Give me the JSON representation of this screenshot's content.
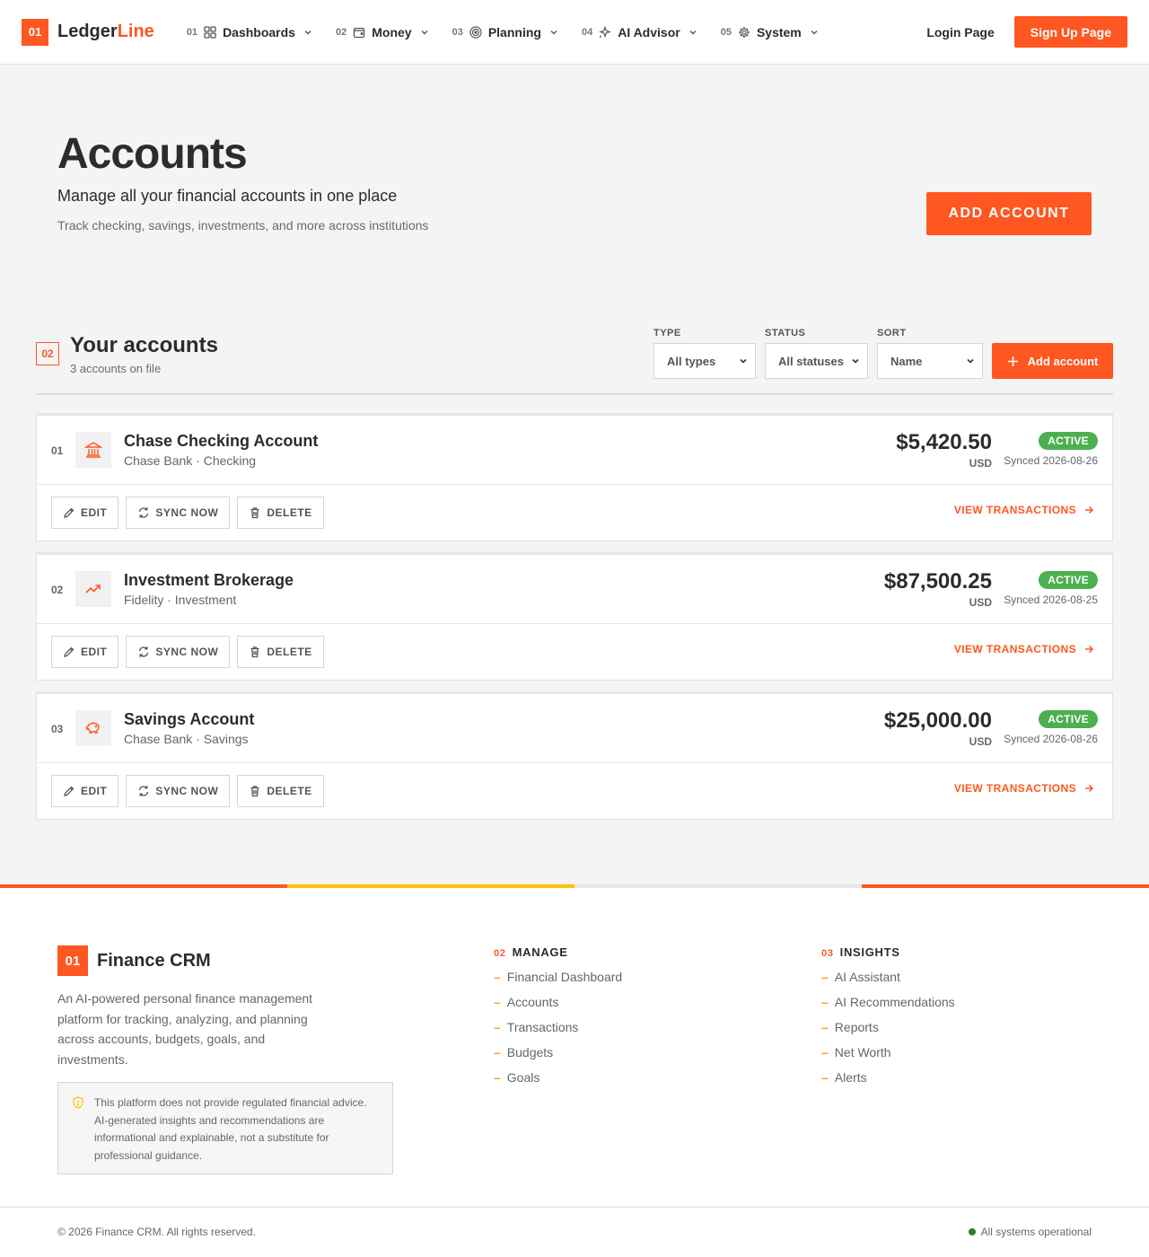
{
  "header": {
    "logo_badge": "01",
    "logo_name_a": "Ledger",
    "logo_name_b": "Line",
    "nav": [
      {
        "num": "01",
        "label": "Dashboards",
        "icon": "grid-icon"
      },
      {
        "num": "02",
        "label": "Money",
        "icon": "wallet-icon"
      },
      {
        "num": "03",
        "label": "Planning",
        "icon": "target-icon"
      },
      {
        "num": "04",
        "label": "AI Advisor",
        "icon": "sparkle-icon"
      },
      {
        "num": "05",
        "label": "System",
        "icon": "gear-icon"
      }
    ],
    "login": "Login Page",
    "signup": "Sign Up Page"
  },
  "hero": {
    "title": "Accounts",
    "subtitle": "Manage all your financial accounts in one place",
    "description": "Track checking, savings, investments, and more across institutions",
    "cta": "ADD ACCOUNT"
  },
  "accounts_section": {
    "num": "02",
    "title": "Your accounts",
    "count": "3 accounts on file",
    "filters": {
      "type_label": "TYPE",
      "type_value": "All types",
      "status_label": "STATUS",
      "status_value": "All statuses",
      "sort_label": "SORT",
      "sort_value": "Name"
    },
    "add_button": "Add account"
  },
  "accounts": [
    {
      "num": "01",
      "icon": "bank-icon",
      "name": "Chase Checking Account",
      "meta": "Chase Bank · Checking",
      "balance": "$5,420.50",
      "currency": "USD",
      "status": "ACTIVE",
      "synced": "Synced 2026-08-26"
    },
    {
      "num": "02",
      "icon": "trending-up-icon",
      "name": "Investment Brokerage",
      "meta": "Fidelity · Investment",
      "balance": "$87,500.25",
      "currency": "USD",
      "status": "ACTIVE",
      "synced": "Synced 2026-08-25"
    },
    {
      "num": "03",
      "icon": "piggy-bank-icon",
      "name": "Savings Account",
      "meta": "Chase Bank · Savings",
      "balance": "$25,000.00",
      "currency": "USD",
      "status": "ACTIVE",
      "synced": "Synced 2026-08-26"
    }
  ],
  "card_actions": {
    "edit": "EDIT",
    "sync": "SYNC NOW",
    "delete": "DELETE",
    "view": "VIEW TRANSACTIONS"
  },
  "footer": {
    "logo_badge": "01",
    "brand": "Finance CRM",
    "description": "An AI-powered personal finance management platform for tracking, analyzing, and planning across accounts, budgets, goals, and investments.",
    "disclaimer": "This platform does not provide regulated financial advice. AI-generated insights and recommendations are informational and explainable, not a substitute for professional guidance.",
    "manage": {
      "num": "02",
      "title": "MANAGE",
      "links": [
        "Financial Dashboard",
        "Accounts",
        "Transactions",
        "Budgets",
        "Goals"
      ]
    },
    "insights": {
      "num": "03",
      "title": "INSIGHTS",
      "links": [
        "AI Assistant",
        "AI Recommendations",
        "Reports",
        "Net Worth",
        "Alerts"
      ]
    },
    "copyright": "© 2026 Finance CRM. All rights reserved.",
    "status": "All systems operational"
  },
  "colors": {
    "accent": "#ff5722",
    "active": "#4caf50",
    "warning": "#ffc107",
    "ok": "#2e7d32"
  }
}
